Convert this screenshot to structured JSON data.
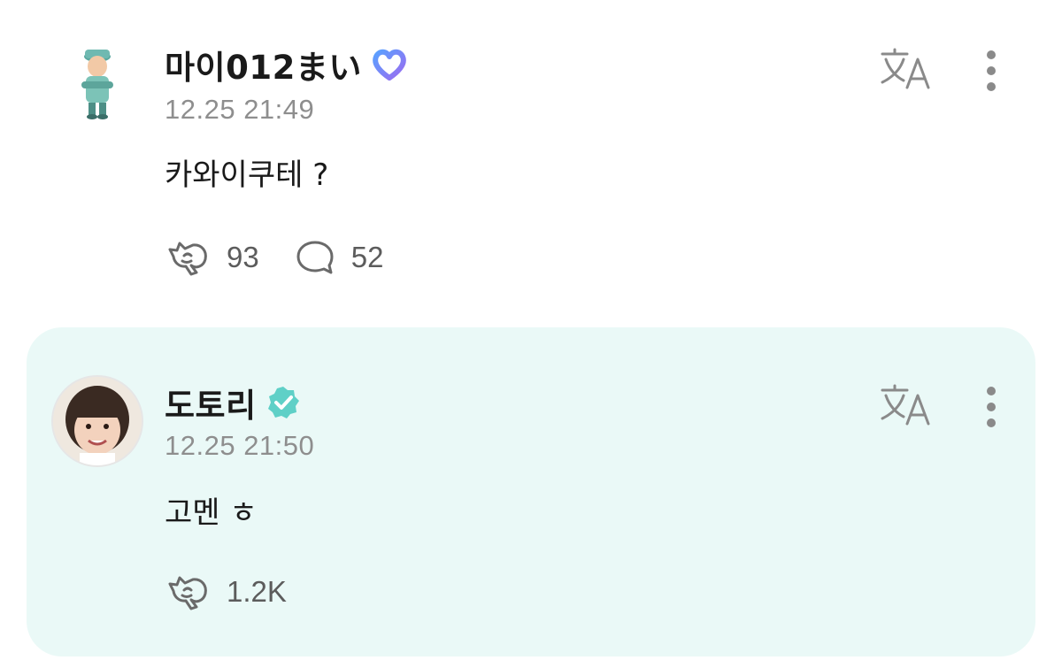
{
  "post": {
    "author": "마이012まい",
    "timestamp": "12.25 21:49",
    "body": "카와이쿠테 ?",
    "reactions": "93",
    "comments": "52",
    "badge_icon": "heart-outline-badge-icon",
    "colors": {
      "badge": "#7b6cf0"
    }
  },
  "reply": {
    "author": "도토리",
    "timestamp": "12.25 21:50",
    "body": "고멘 ㅎ",
    "reactions": "1.2K",
    "badge_icon": "verified-check-badge-icon",
    "colors": {
      "card_bg": "#eaf9f7",
      "badge": "#4ecdc4"
    }
  },
  "icons": {
    "translate": "translate-icon",
    "more": "more-vertical-icon",
    "react": "reaction-hand-icon",
    "comment": "comment-bubble-icon"
  }
}
